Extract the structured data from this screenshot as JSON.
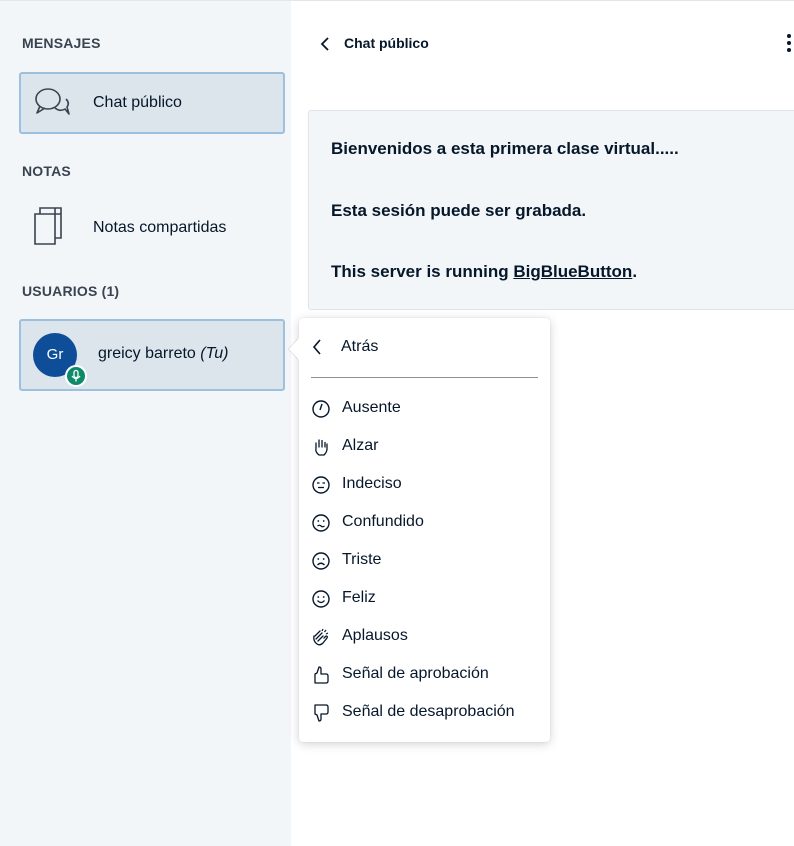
{
  "sidebar": {
    "messages_title": "MENSAJES",
    "public_chat_label": "Chat público",
    "notes_title": "NOTAS",
    "shared_notes_label": "Notas compartidas",
    "users_title": "USUARIOS (1)",
    "user": {
      "initials": "Gr",
      "name": "greicy barreto",
      "you_tag": "(Tu)"
    }
  },
  "chat": {
    "title": "Chat público",
    "welcome_line1": "Bienvenidos a esta primera clase virtual.....",
    "welcome_line2": "Esta sesión puede ser grabada.",
    "welcome_line3_prefix": "This server is running ",
    "welcome_line3_link": "BigBlueButton",
    "welcome_line3_suffix": "."
  },
  "status_menu": {
    "back_label": "Atrás",
    "items": [
      {
        "label": "Ausente",
        "icon": "clock-icon"
      },
      {
        "label": "Alzar",
        "icon": "hand-icon"
      },
      {
        "label": "Indeciso",
        "icon": "undecided-face-icon"
      },
      {
        "label": "Confundido",
        "icon": "confused-face-icon"
      },
      {
        "label": "Triste",
        "icon": "sad-face-icon"
      },
      {
        "label": "Feliz",
        "icon": "happy-face-icon"
      },
      {
        "label": "Aplausos",
        "icon": "applause-icon"
      },
      {
        "label": "Señal de aprobación",
        "icon": "thumbs-up-icon"
      },
      {
        "label": "Señal de desaprobación",
        "icon": "thumbs-down-icon"
      }
    ]
  },
  "colors": {
    "sidebar_bg": "#f3f6f9",
    "selected_bg": "#dce4ec",
    "selected_border": "#9cc0dd",
    "avatar_bg": "#0e4d98",
    "mic_badge": "#0d8a6a"
  }
}
